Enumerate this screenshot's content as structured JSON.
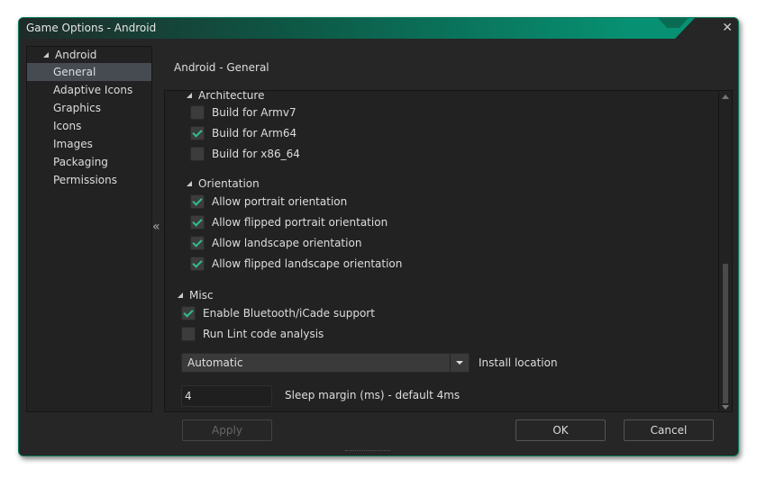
{
  "window": {
    "title": "Game Options - Android"
  },
  "sidebar": {
    "root": "Android",
    "items": [
      {
        "label": "General",
        "selected": true
      },
      {
        "label": "Adaptive Icons"
      },
      {
        "label": "Graphics"
      },
      {
        "label": "Icons"
      },
      {
        "label": "Images"
      },
      {
        "label": "Packaging"
      },
      {
        "label": "Permissions"
      }
    ]
  },
  "main": {
    "heading": "Android - General",
    "architecture": {
      "title": "Architecture",
      "options": [
        {
          "label": "Build for Armv7",
          "checked": false
        },
        {
          "label": "Build for Arm64",
          "checked": true
        },
        {
          "label": "Build for x86_64",
          "checked": false
        }
      ]
    },
    "orientation": {
      "title": "Orientation",
      "options": [
        {
          "label": "Allow portrait orientation",
          "checked": true
        },
        {
          "label": "Allow flipped portrait orientation",
          "checked": true
        },
        {
          "label": "Allow landscape orientation",
          "checked": true
        },
        {
          "label": "Allow flipped landscape orientation",
          "checked": true
        }
      ]
    },
    "misc": {
      "title": "Misc",
      "options": [
        {
          "label": "Enable Bluetooth/iCade support",
          "checked": true
        },
        {
          "label": "Run Lint code analysis",
          "checked": false
        }
      ],
      "install_location": {
        "value": "Automatic",
        "label": "Install location"
      },
      "sleep_margin": {
        "value": "4",
        "label": "Sleep margin (ms) - default 4ms"
      }
    }
  },
  "buttons": {
    "apply": "Apply",
    "ok": "OK",
    "cancel": "Cancel"
  },
  "colors": {
    "accent": "#079172",
    "check": "#2fbf8c"
  }
}
